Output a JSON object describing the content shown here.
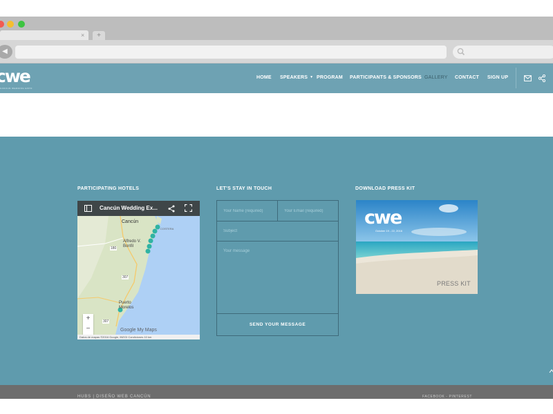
{
  "browser": {
    "tab_close": "×",
    "new_tab": "+",
    "back_icon": "back-arrow-icon",
    "search_icon": "search-icon"
  },
  "header": {
    "logo": "cwe",
    "tagline": "CANCUN WEDDING EXPO",
    "nav": [
      {
        "label": "HOME",
        "active": false
      },
      {
        "label": "SPEAKERS",
        "active": false,
        "has_dropdown": true
      },
      {
        "label": "PROGRAM",
        "active": false
      },
      {
        "label": "PARTICIPANTS & SPONSORS",
        "active": false
      },
      {
        "label": "GALLERY",
        "active": true
      },
      {
        "label": "CONTACT",
        "active": false
      },
      {
        "label": "SIGN UP",
        "active": false
      }
    ],
    "icons": [
      "mail-icon",
      "share-icon"
    ],
    "bg_color": "#6ea2b3"
  },
  "sections": {
    "hotels_title": "PARTICIPATING HOTELS",
    "contact_title": "LET'S STAY IN TOUCH",
    "press_title": "DOWNLOAD PRESS KIT"
  },
  "map": {
    "title": "Cancún Wedding Ex...",
    "labels": [
      "Cancún",
      "Alfredo V. Bonfil",
      "Puerto Morelos",
      "COSTERA"
    ],
    "road_labels": [
      "180",
      "307",
      "307"
    ],
    "zoom_in": "+",
    "zoom_out": "−",
    "google": "Google My Maps",
    "footer": "Datos de mapas ©2016 Google, INEGI   Condiciones   10 km"
  },
  "form": {
    "name_placeholder": "Your Name (required)",
    "email_placeholder": "Your Email (required)",
    "subject_placeholder": "Subject",
    "message_placeholder": "Your message",
    "submit_label": "SEND YOUR MESSAGE"
  },
  "press_kit": {
    "logo": "cwe",
    "date": "October 19 - 22, 2016",
    "label": "PRESS KIT"
  },
  "footer": {
    "left_text": "HUBS | DISEÑO WEB CANCÚN",
    "right_text": "FACEBOOK - PINTEREST"
  },
  "colors": {
    "teal_section": "#5f9bad",
    "header": "#6ea2b3",
    "bottom_bar": "#6d6d6d"
  }
}
